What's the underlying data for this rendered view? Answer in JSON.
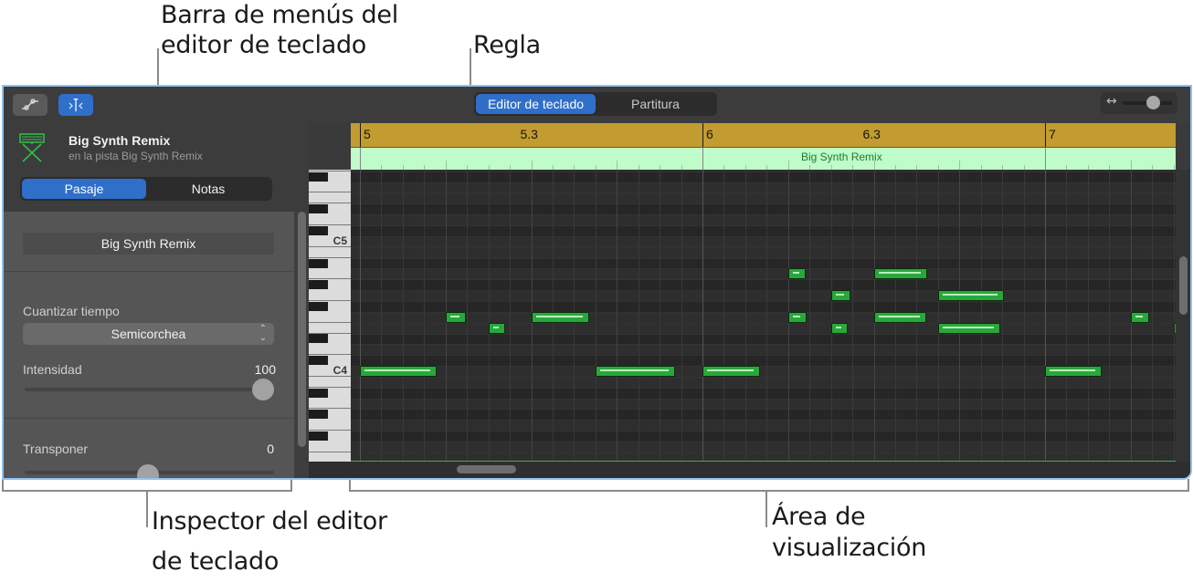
{
  "callouts": {
    "menu_bar": "Barra de menús del\neditor de teclado",
    "menu_bar_line1": "Barra de menús del",
    "menu_bar_line2": "editor de teclado",
    "ruler": "Regla",
    "inspector_line1": "Inspector del editor",
    "inspector_line2": "de teclado",
    "display_line1": "Área de",
    "display_line2": "visualización"
  },
  "toolbar": {
    "automation_button": "automation-curve-icon",
    "catch_button": "playhead-catch-icon",
    "view_tabs": [
      {
        "label": "Editor de teclado",
        "active": true
      },
      {
        "label": "Partitura",
        "active": false
      }
    ],
    "zoom_icon": "↔",
    "zoom_level": 0.6
  },
  "inspector": {
    "region_title": "Big Synth Remix",
    "region_subtitle": "en la pista Big Synth Remix",
    "tabs": [
      {
        "label": "Pasaje",
        "active": true
      },
      {
        "label": "Notas",
        "active": false
      }
    ],
    "region_name_field": "Big Synth Remix",
    "quantize_label": "Cuantizar tiempo",
    "quantize_value": "Semicorchea",
    "strength_label": "Intensidad",
    "strength_value": "100",
    "strength_fraction": 1.0,
    "transpose_label": "Transponer",
    "transpose_value": "0",
    "transpose_fraction": 0.5
  },
  "ruler": {
    "markers": [
      {
        "label": "5",
        "bar": 5,
        "major": true
      },
      {
        "label": "5.3",
        "bar": 5.5,
        "major": false
      },
      {
        "label": "6",
        "bar": 6,
        "major": true
      },
      {
        "label": "6.3",
        "bar": 6.5,
        "major": false
      },
      {
        "label": "7",
        "bar": 7,
        "major": true
      }
    ],
    "region_label": "Big Synth Remix"
  },
  "piano": {
    "labels": [
      {
        "text": "C5",
        "midi": 72
      },
      {
        "text": "C4",
        "midi": 60
      }
    ]
  },
  "notes": [
    {
      "pitch": 60,
      "start": 0,
      "length": 3.6
    },
    {
      "pitch": 65,
      "start": 4,
      "length": 0.95
    },
    {
      "pitch": 64,
      "start": 6,
      "length": 0.8
    },
    {
      "pitch": 65,
      "start": 8,
      "length": 2.7
    },
    {
      "pitch": 60,
      "start": 11,
      "length": 3.7
    },
    {
      "pitch": 60,
      "start": 16,
      "length": 2.7
    },
    {
      "pitch": 69,
      "start": 20,
      "length": 0.8
    },
    {
      "pitch": 65,
      "start": 20,
      "length": 0.85
    },
    {
      "pitch": 67,
      "start": 22,
      "length": 0.9
    },
    {
      "pitch": 64,
      "start": 22,
      "length": 0.8
    },
    {
      "pitch": 69,
      "start": 24,
      "length": 2.5
    },
    {
      "pitch": 65,
      "start": 24,
      "length": 2.45
    },
    {
      "pitch": 67,
      "start": 27,
      "length": 3.1
    },
    {
      "pitch": 64,
      "start": 27,
      "length": 2.9
    },
    {
      "pitch": 60,
      "start": 32,
      "length": 2.65
    },
    {
      "pitch": 65,
      "start": 36,
      "length": 0.85
    },
    {
      "pitch": 64,
      "start": 38,
      "length": 0.3
    }
  ]
}
